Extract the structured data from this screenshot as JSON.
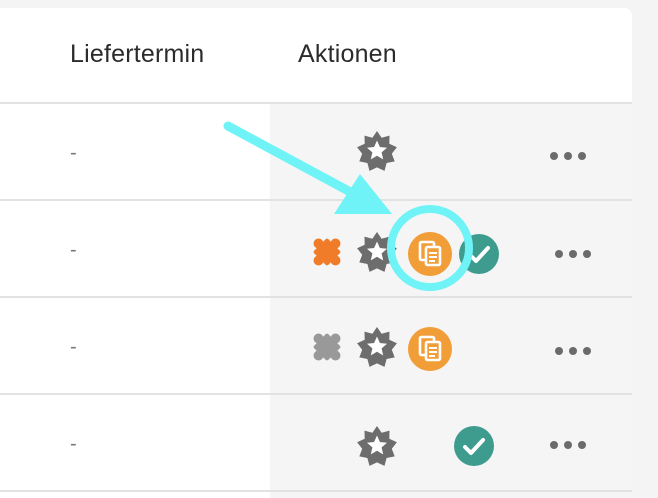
{
  "table": {
    "columns": {
      "liefertermin": "Liefertermin",
      "aktionen": "Aktionen"
    },
    "rows": [
      {
        "liefertermin": "-",
        "actions": [
          "star-badge-icon"
        ],
        "more": "more-options-icon"
      },
      {
        "liefertermin": "-",
        "actions": [
          "puzzle-icon-orange",
          "star-badge-icon",
          "copy-document-icon",
          "check-circle-icon"
        ],
        "more": "more-options-icon"
      },
      {
        "liefertermin": "-",
        "actions": [
          "puzzle-icon-gray",
          "star-badge-icon",
          "copy-document-icon"
        ],
        "more": "more-options-icon"
      },
      {
        "liefertermin": "-",
        "actions": [
          "star-badge-icon",
          "check-circle-icon"
        ],
        "more": "more-options-icon"
      }
    ]
  },
  "colors": {
    "badge_gray": "#6d6d6d",
    "puzzle_orange": "#f07c2a",
    "puzzle_gray": "#999999",
    "copy_orange": "#f19d38",
    "check_teal": "#3e9c8e",
    "highlight_cyan": "#6ff3f7"
  },
  "annotations": {
    "arrow": "highlight-arrow",
    "circle": "highlight-circle"
  }
}
